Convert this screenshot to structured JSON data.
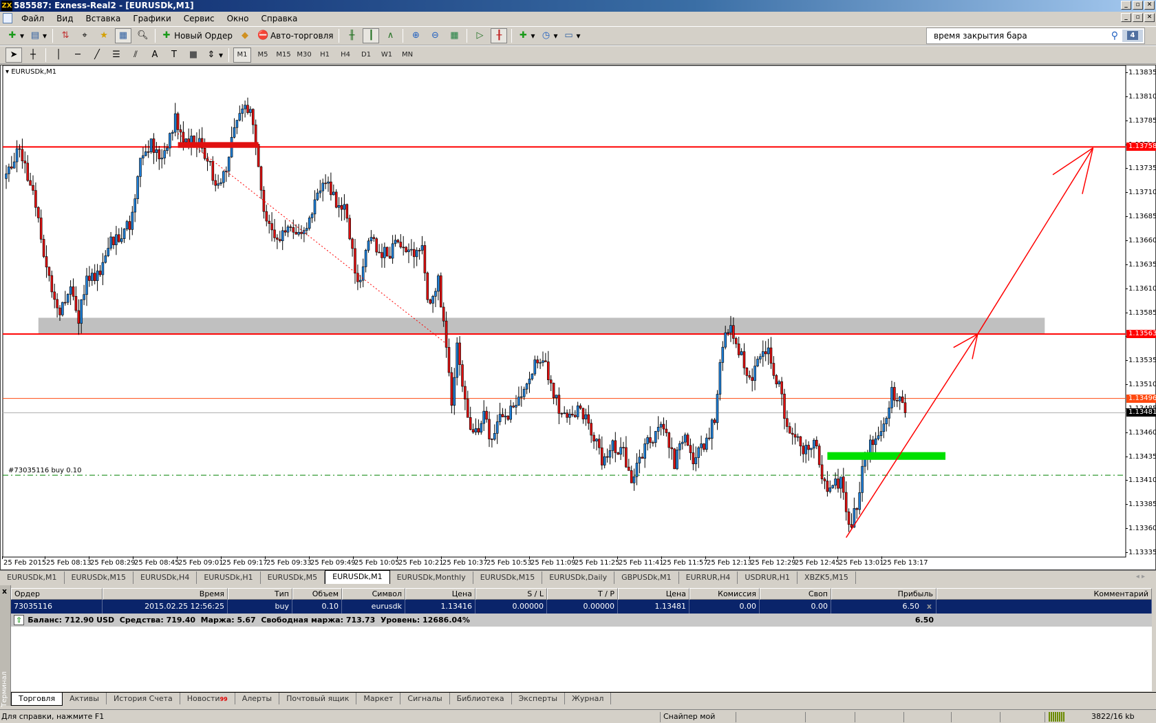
{
  "window": {
    "title": "585587: Exness-Real2 - [EURUSDk,M1]",
    "logo": "ZX"
  },
  "menu": [
    "Файл",
    "Вид",
    "Вставка",
    "Графики",
    "Сервис",
    "Окно",
    "Справка"
  ],
  "toolbar": {
    "new_order": "Новый Ордер",
    "auto_trading": "Авто-торговля",
    "timeframes": [
      "M1",
      "M5",
      "M15",
      "M30",
      "H1",
      "H4",
      "D1",
      "W1",
      "MN"
    ],
    "active_timeframe": "M1"
  },
  "search": {
    "value": "время закрытия бара",
    "badge": "4"
  },
  "chart": {
    "symbol_label": "EURUSDk,M1",
    "order_label": "#73035116 buy 0.10"
  },
  "colors": {
    "bull": "#1e7fd8",
    "bear": "#e01010",
    "level": "#ff0000",
    "orange": "#ff4a10",
    "order": "#008000",
    "zone": "#c0c0c0",
    "green_box": "#00e000"
  },
  "chart_data": {
    "type": "candlestick",
    "symbol": "EURUSDk",
    "timeframe": "M1",
    "ylim": [
      1.13335,
      1.13835
    ],
    "price_ticks": [
      "1.13835",
      "1.13810",
      "1.13785",
      "1.13760",
      "1.13735",
      "1.13710",
      "1.13685",
      "1.13660",
      "1.13635",
      "1.13610",
      "1.13585",
      "1.13560",
      "1.13535",
      "1.13510",
      "1.13485",
      "1.13460",
      "1.13435",
      "1.13410",
      "1.13385",
      "1.13360",
      "1.13335"
    ],
    "time_ticks": [
      "25 Feb 2015",
      "25 Feb 08:13",
      "25 Feb 08:29",
      "25 Feb 08:45",
      "25 Feb 09:01",
      "25 Feb 09:17",
      "25 Feb 09:33",
      "25 Feb 09:49",
      "25 Feb 10:05",
      "25 Feb 10:21",
      "25 Feb 10:37",
      "25 Feb 10:53",
      "25 Feb 11:09",
      "25 Feb 11:25",
      "25 Feb 11:41",
      "25 Feb 11:57",
      "25 Feb 12:13",
      "25 Feb 12:29",
      "25 Feb 12:45",
      "25 Feb 13:01",
      "25 Feb 13:17"
    ],
    "candle_count": 336,
    "close_path": [
      [
        0,
        1.13725
      ],
      [
        5,
        1.13756
      ],
      [
        9,
        1.13721
      ],
      [
        13,
        1.13664
      ],
      [
        17,
        1.1361
      ],
      [
        20,
        1.13587
      ],
      [
        24,
        1.13618
      ],
      [
        27,
        1.13579
      ],
      [
        30,
        1.13618
      ],
      [
        34,
        1.13625
      ],
      [
        38,
        1.13656
      ],
      [
        42,
        1.13664
      ],
      [
        46,
        1.13679
      ],
      [
        50,
        1.13744
      ],
      [
        54,
        1.13764
      ],
      [
        58,
        1.13741
      ],
      [
        63,
        1.1379
      ],
      [
        67,
        1.1376
      ],
      [
        71,
        1.13764
      ],
      [
        75,
        1.13748
      ],
      [
        78,
        1.1371
      ],
      [
        80,
        1.13717
      ],
      [
        83,
        1.13752
      ],
      [
        87,
        1.13794
      ],
      [
        91,
        1.13794
      ],
      [
        93,
        1.13756
      ],
      [
        96,
        1.13694
      ],
      [
        100,
        1.13656
      ],
      [
        104,
        1.13671
      ],
      [
        108,
        1.13664
      ],
      [
        112,
        1.13679
      ],
      [
        116,
        1.13706
      ],
      [
        119,
        1.13721
      ],
      [
        123,
        1.13702
      ],
      [
        127,
        1.13687
      ],
      [
        131,
        1.1361
      ],
      [
        134,
        1.13656
      ],
      [
        138,
        1.13656
      ],
      [
        142,
        1.13644
      ],
      [
        146,
        1.13656
      ],
      [
        150,
        1.13648
      ],
      [
        155,
        1.13656
      ],
      [
        157,
        1.13595
      ],
      [
        161,
        1.13618
      ],
      [
        164,
        1.13556
      ],
      [
        166,
        1.13495
      ],
      [
        168,
        1.13556
      ],
      [
        171,
        1.13495
      ],
      [
        174,
        1.13456
      ],
      [
        178,
        1.13479
      ],
      [
        181,
        1.13449
      ],
      [
        185,
        1.13479
      ],
      [
        189,
        1.13483
      ],
      [
        193,
        1.1351
      ],
      [
        197,
        1.13533
      ],
      [
        201,
        1.13529
      ],
      [
        204,
        1.13502
      ],
      [
        207,
        1.13476
      ],
      [
        211,
        1.13472
      ],
      [
        214,
        1.13487
      ],
      [
        218,
        1.13464
      ],
      [
        222,
        1.13433
      ],
      [
        226,
        1.13445
      ],
      [
        230,
        1.13441
      ],
      [
        233,
        1.13414
      ],
      [
        237,
        1.13441
      ],
      [
        241,
        1.13456
      ],
      [
        245,
        1.13464
      ],
      [
        249,
        1.13426
      ],
      [
        253,
        1.1346
      ],
      [
        256,
        1.1343
      ],
      [
        260,
        1.13449
      ],
      [
        264,
        1.13472
      ],
      [
        267,
        1.13556
      ],
      [
        270,
        1.13564
      ],
      [
        273,
        1.13549
      ],
      [
        277,
        1.1351
      ],
      [
        280,
        1.13541
      ],
      [
        284,
        1.13541
      ],
      [
        288,
        1.1351
      ],
      [
        291,
        1.13464
      ],
      [
        295,
        1.13449
      ],
      [
        299,
        1.13441
      ],
      [
        302,
        1.13449
      ],
      [
        304,
        1.1341
      ],
      [
        307,
        1.13403
      ],
      [
        311,
        1.1341
      ],
      [
        314,
        1.13364
      ],
      [
        317,
        1.1338
      ],
      [
        319,
        1.13418
      ],
      [
        322,
        1.13449
      ],
      [
        325,
        1.13464
      ],
      [
        328,
        1.13479
      ],
      [
        330,
        1.13502
      ],
      [
        333,
        1.13495
      ],
      [
        335,
        1.13481
      ]
    ],
    "levels": [
      {
        "price": 1.13758,
        "label": "1.13758",
        "style": "level"
      },
      {
        "price": 1.13563,
        "label": "1.13563",
        "style": "level"
      },
      {
        "price": 1.13496,
        "label": "1.13496",
        "style": "orange"
      },
      {
        "price": 1.13481,
        "label": "1.13481",
        "style": "bid"
      },
      {
        "price": 1.13416,
        "label": "",
        "style": "order"
      }
    ],
    "zone": {
      "from": 12,
      "to": 387,
      "low": 1.13563,
      "high": 1.1358
    },
    "boxes": [
      {
        "from": 64,
        "to": 94,
        "low": 1.13757,
        "high": 1.13763,
        "color": "bear"
      },
      {
        "from": 306,
        "to": 350,
        "low": 1.13432,
        "high": 1.1344,
        "color": "green_box"
      }
    ],
    "trendline": {
      "from": [
        64,
        1.13772
      ],
      "to": [
        164,
        1.13553
      ]
    },
    "arrows": [
      {
        "from": [
          313,
          1.13351
        ],
        "to": [
          362,
          1.13563
        ],
        "head": [
          [
            353,
            1.13549
          ],
          [
            360,
            1.13537
          ]
        ]
      },
      {
        "from": [
          362,
          1.13563
        ],
        "to": [
          405,
          1.13757
        ],
        "head": [
          [
            390,
            1.13729
          ],
          [
            401,
            1.13709
          ]
        ]
      }
    ]
  },
  "chart_tabs": [
    "EURUSDk,M1",
    "EURUSDk,M15",
    "EURUSDk,H4",
    "EURUSDk,H1",
    "EURUSDk,M5",
    "EURUSDk,M1",
    "EURUSDk,Monthly",
    "EURUSDk,M15",
    "EURUSDk,Daily",
    "GBPUSDk,M1",
    "EURRUR,H4",
    "USDRUR,H1",
    "XBZK5,M15"
  ],
  "active_chart_tab": 5,
  "terminal": {
    "side_label": "Терминал",
    "columns": [
      "Ордер",
      "Время",
      "Тип",
      "Объем",
      "Символ",
      "Цена",
      "S / L",
      "T / P",
      "Цена",
      "Комиссия",
      "Своп",
      "Прибыль",
      "Комментарий"
    ],
    "rows": [
      [
        "73035116",
        "2015.02.25 12:56:25",
        "buy",
        "0.10",
        "eurusdk",
        "1.13416",
        "0.00000",
        "0.00000",
        "1.13481",
        "0.00",
        "0.00",
        "6.50",
        ""
      ]
    ],
    "balance": "Баланс: 712.90 USD  Средства: 719.40  Маржа: 5.67  Свободная маржа: 713.73  Уровень: 12686.04%",
    "total_profit": "6.50",
    "tabs": [
      {
        "label": "Торговля"
      },
      {
        "label": "Активы"
      },
      {
        "label": "История Счета"
      },
      {
        "label": "Новости",
        "badge": "99"
      },
      {
        "label": "Алерты"
      },
      {
        "label": "Почтовый ящик"
      },
      {
        "label": "Маркет"
      },
      {
        "label": "Сигналы"
      },
      {
        "label": "Библиотека"
      },
      {
        "label": "Эксперты"
      },
      {
        "label": "Журнал"
      }
    ]
  },
  "status": {
    "help": "Для справки, нажмите F1",
    "profile": "Снайпер мой",
    "traffic": "3822/16 kb"
  }
}
